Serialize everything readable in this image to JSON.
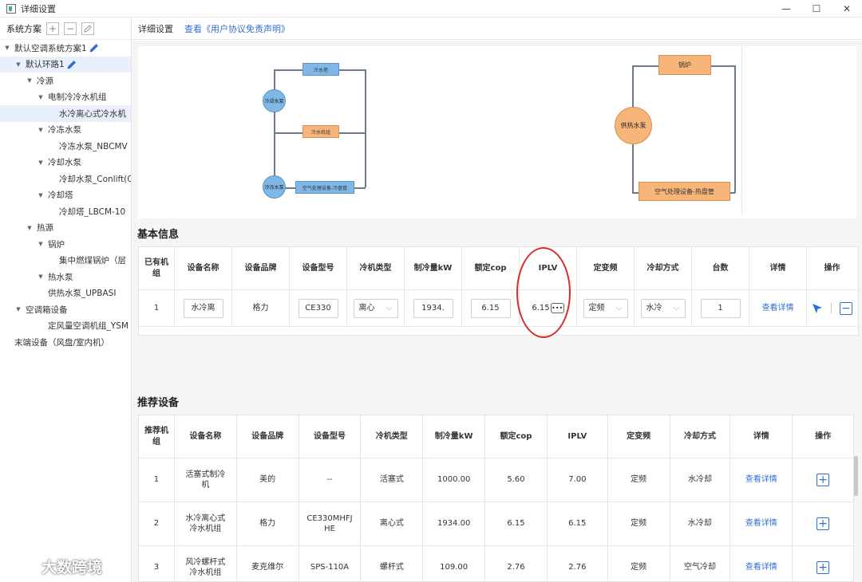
{
  "window": {
    "title": "详细设置",
    "min": "—",
    "max": "☐",
    "close": "✕"
  },
  "sidebar": {
    "header_label": "系统方案",
    "add": "+",
    "remove": "−",
    "items": [
      "默认空调系统方案1",
      "默认环路1",
      "冷源",
      "电制冷冷水机组",
      "水冷离心式冷水机",
      "冷冻水泵",
      "冷冻水泵_NBCMV",
      "冷却水泵",
      "冷却水泵_Conlift(C",
      "冷却塔",
      "冷却塔_LBCM-10",
      "热源",
      "锅炉",
      "集中燃煤锅炉（层",
      "热水泵",
      "供热水泵_UPBASI",
      "空调箱设备",
      "定风量空调机组_YSM",
      "末端设备（风盘/室内机）"
    ]
  },
  "topbar": {
    "title": "详细设置",
    "link": "查看《用户协议免责声明》"
  },
  "diagram_left": {
    "cooling_tower": "冷水塔",
    "cooling_pump": "冷却水泵",
    "chiller": "冷水机组",
    "chilled_pump": "冷冻水泵",
    "ahu_cool": "空气处理设备-冷盘管"
  },
  "diagram_right": {
    "boiler": "锅炉",
    "hot_pump": "供热水泵",
    "ahu_heat": "空气处理设备-热盘管"
  },
  "basic": {
    "title": "基本信息",
    "headers": [
      "已有机组",
      "设备名称",
      "设备品牌",
      "设备型号",
      "冷机类型",
      "制冷量kW",
      "额定cop",
      "IPLV",
      "定变频",
      "冷却方式",
      "台数",
      "详情",
      "操作"
    ],
    "row": {
      "index": "1",
      "name": "水冷离",
      "brand": "格力",
      "model": "CE330",
      "type": "离心",
      "capacity": "1934.",
      "cop": "6.15",
      "iplv": "6.15",
      "freq": "定频",
      "cooling": "水冷",
      "count": "1",
      "detail": "查看详情"
    }
  },
  "recommend": {
    "title": "推荐设备",
    "headers": [
      "推荐机组",
      "设备名称",
      "设备品牌",
      "设备型号",
      "冷机类型",
      "制冷量kW",
      "额定cop",
      "IPLV",
      "定变频",
      "冷却方式",
      "详情",
      "操作"
    ],
    "rows": [
      {
        "index": "1",
        "name": "活塞式制冷机",
        "brand": "美的",
        "model": "--",
        "type": "活塞式",
        "capacity": "1000.00",
        "cop": "5.60",
        "iplv": "7.00",
        "freq": "定频",
        "cooling": "水冷却",
        "detail": "查看详情"
      },
      {
        "index": "2",
        "name": "水冷离心式冷水机组",
        "brand": "格力",
        "model": "CE330MHFJHE",
        "type": "离心式",
        "capacity": "1934.00",
        "cop": "6.15",
        "iplv": "6.15",
        "freq": "定频",
        "cooling": "水冷却",
        "detail": "查看详情"
      },
      {
        "index": "3",
        "name": "风冷螺杆式冷水机组",
        "brand": "麦克维尔",
        "model": "SPS-110A",
        "type": "螺杆式",
        "capacity": "109.00",
        "cop": "2.76",
        "iplv": "2.76",
        "freq": "定频",
        "cooling": "空气冷却",
        "detail": "查看详情"
      }
    ]
  },
  "watermark": "大数跨境"
}
